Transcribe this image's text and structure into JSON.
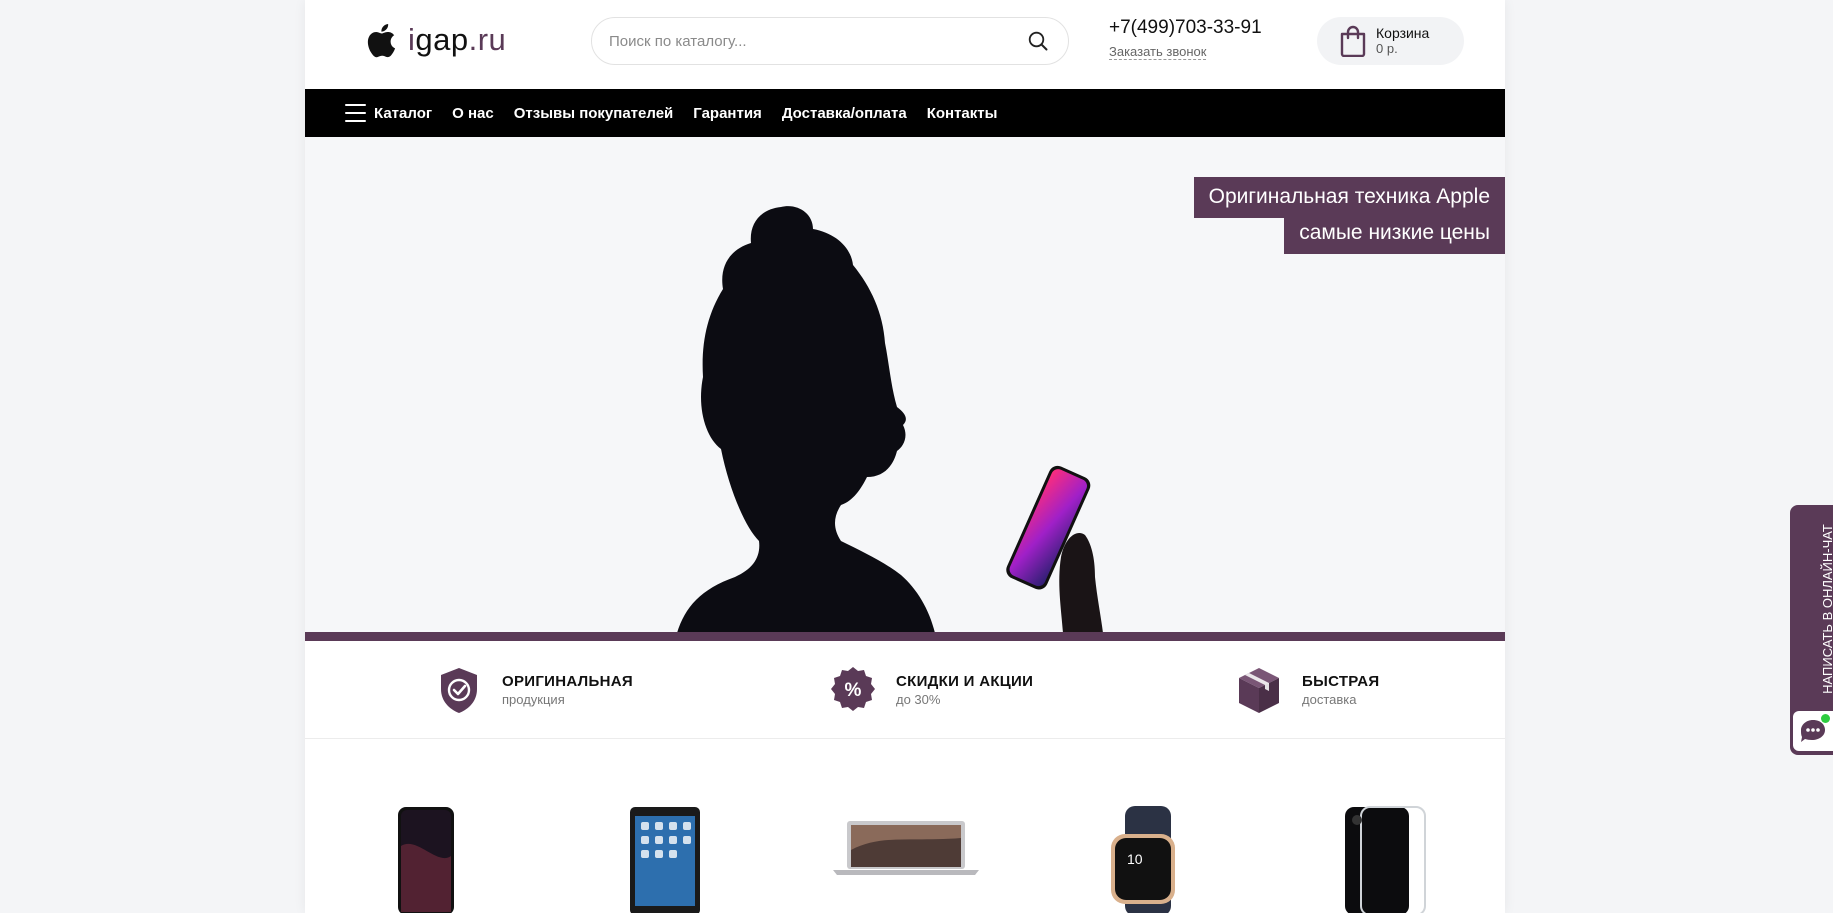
{
  "header": {
    "logo": {
      "prefix": "i",
      "name": "gap",
      "tld": ".ru"
    },
    "search": {
      "placeholder": "Поиск по каталогу..."
    },
    "phone": "+7(499)703-33-91",
    "callback": "Заказать звонок",
    "cart": {
      "label": "Корзина",
      "sum": "0 р."
    }
  },
  "nav": {
    "items": [
      {
        "label": "Каталог"
      },
      {
        "label": "О нас"
      },
      {
        "label": "Отзывы покупателей"
      },
      {
        "label": "Гарантия"
      },
      {
        "label": "Доставка/оплата"
      },
      {
        "label": "Контакты"
      }
    ]
  },
  "hero": {
    "promo_line1": "Оригинальная техника Apple",
    "promo_line2": "самые низкие цены"
  },
  "features": [
    {
      "icon": "shield-check-icon",
      "title": "ОРИГИНАЛЬНАЯ",
      "subtitle": "продукция"
    },
    {
      "icon": "percent-badge-icon",
      "title": "СКИДКИ И АКЦИИ",
      "subtitle": "до 30%"
    },
    {
      "icon": "box-icon",
      "title": "БЫСТРАЯ",
      "subtitle": "доставка"
    }
  ],
  "products": [
    {
      "icon": "iphone-xr-image"
    },
    {
      "icon": "ipad-mini-image"
    },
    {
      "icon": "macbook-air-image"
    },
    {
      "icon": "apple-watch-image"
    },
    {
      "icon": "iphone-case-image"
    }
  ],
  "chat": {
    "label": "НАПИСАТЬ В ОНЛАЙН-ЧАТ"
  },
  "colors": {
    "accent": "#5a3a57",
    "nav_bg": "#000000",
    "online": "#2ecc40"
  }
}
